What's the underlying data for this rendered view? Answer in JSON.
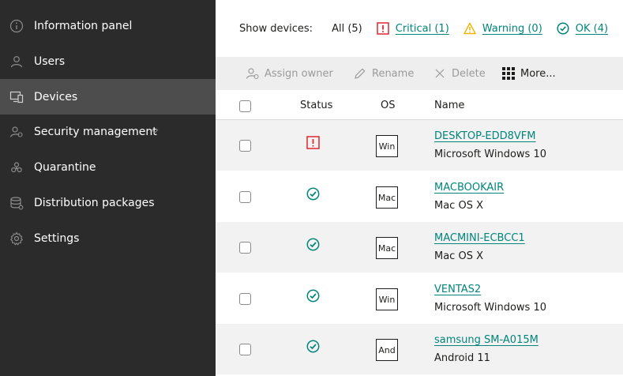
{
  "sidebar": {
    "items": [
      {
        "label": "Information panel",
        "icon": "info-icon",
        "active": false
      },
      {
        "label": "Users",
        "icon": "user-icon",
        "active": false
      },
      {
        "label": "Devices",
        "icon": "devices-icon",
        "active": true
      },
      {
        "label": "Security management",
        "icon": "security-icon",
        "active": false
      },
      {
        "label": "Quarantine",
        "icon": "quarantine-icon",
        "active": false
      },
      {
        "label": "Distribution packages",
        "icon": "packages-icon",
        "active": false
      },
      {
        "label": "Settings",
        "icon": "gear-icon",
        "active": false
      }
    ]
  },
  "filter": {
    "title": "Show devices:",
    "all": "All (5)",
    "critical": "Critical (1)",
    "warning": "Warning (0)",
    "ok": "OK (4)"
  },
  "toolbar": {
    "assign_owner": "Assign owner",
    "rename": "Rename",
    "delete": "Delete",
    "more": "More..."
  },
  "table": {
    "headers": {
      "status": "Status",
      "os": "OS",
      "name": "Name"
    },
    "rows": [
      {
        "status": "critical",
        "os": "Win",
        "name": "DESKTOP-EDD8VFM",
        "os_name": "Microsoft Windows 10"
      },
      {
        "status": "ok",
        "os": "Mac",
        "name": "MACBOOKAIR",
        "os_name": "Mac OS X"
      },
      {
        "status": "ok",
        "os": "Mac",
        "name": "MACMINI-ECBCC1",
        "os_name": "Mac OS X"
      },
      {
        "status": "ok",
        "os": "Win",
        "name": "VENTAS2",
        "os_name": "Microsoft Windows 10"
      },
      {
        "status": "ok",
        "os": "And",
        "name": "samsung SM-A015M",
        "os_name": "Android 11"
      }
    ]
  },
  "colors": {
    "sidebar_bg": "#2b2b2b",
    "sidebar_active": "#4d4d4d",
    "accent": "#00857a",
    "critical": "#e0262e",
    "warning": "#f2b300"
  }
}
